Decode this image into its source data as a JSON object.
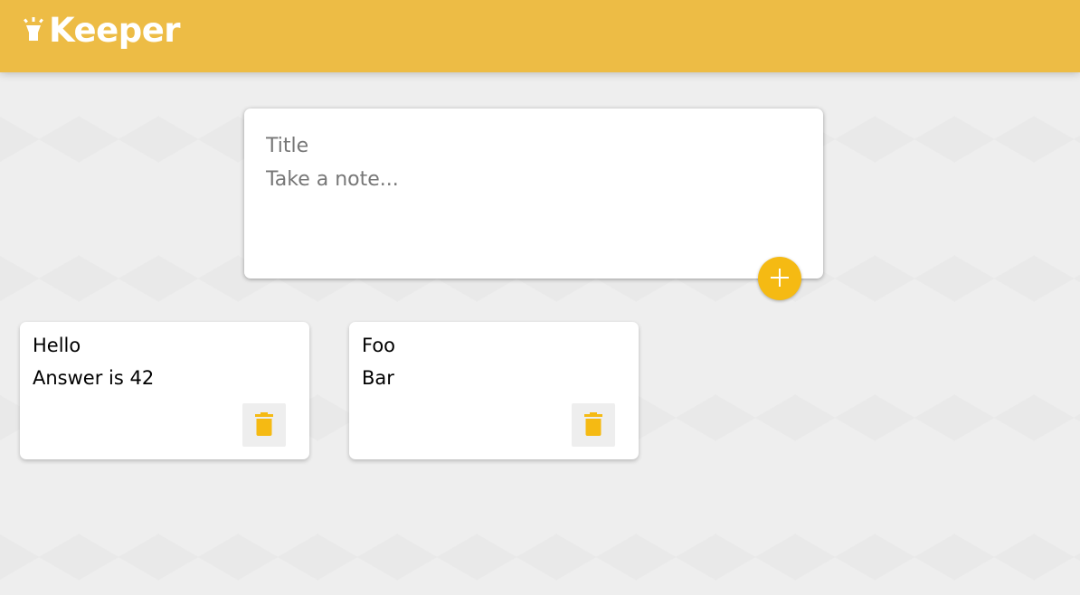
{
  "app": {
    "name": "Keeper",
    "logo_icon": "highlight-lamp-icon"
  },
  "colors": {
    "header": "#edbc45",
    "accent": "#f5ba13",
    "background": "#eeeeee"
  },
  "create_area": {
    "title_placeholder": "Title",
    "content_placeholder": "Take a note...",
    "add_icon": "plus-icon"
  },
  "notes": [
    {
      "title": "Hello",
      "content": "Answer is 42",
      "delete_icon": "trash-icon"
    },
    {
      "title": "Foo",
      "content": "Bar",
      "delete_icon": "trash-icon"
    }
  ]
}
